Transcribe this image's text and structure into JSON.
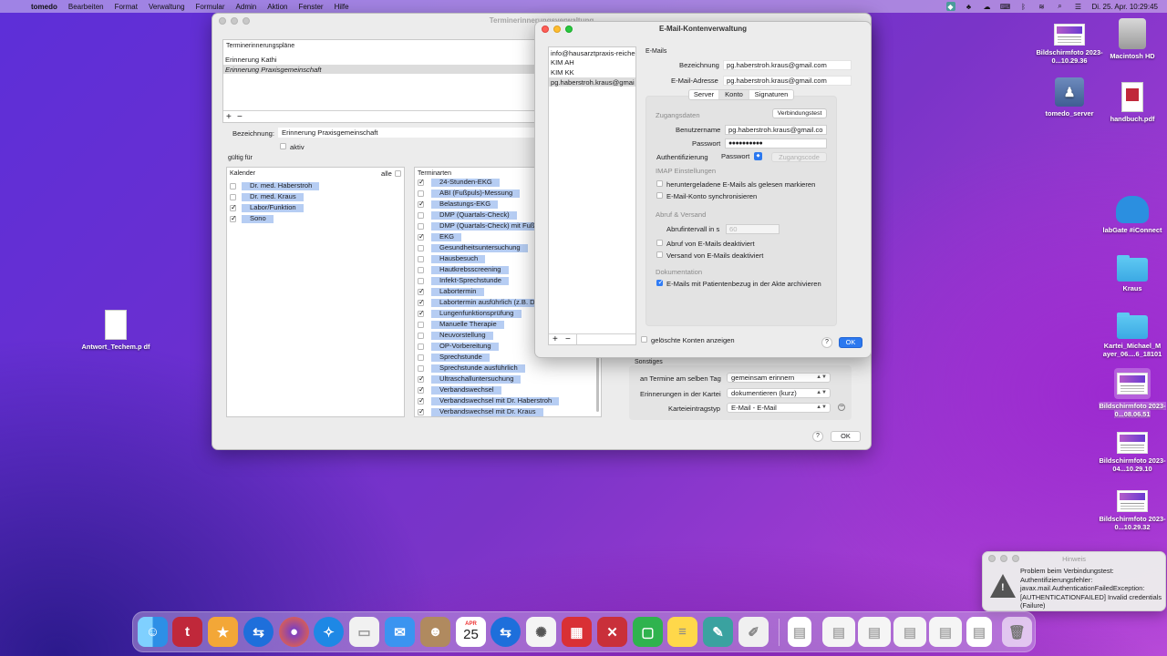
{
  "menubar": {
    "app": "tomedo",
    "items": [
      "Bearbeiten",
      "Format",
      "Verwaltung",
      "Formular",
      "Admin",
      "Aktion",
      "Fenster",
      "Hilfe"
    ],
    "clock": "Di. 25. Apr. 10:29:45"
  },
  "bg_window": {
    "title": "Terminerinnerungsverwaltung",
    "plans_header": "Terminerinnerungspläne",
    "plans": [
      "Erinnerung Kathi",
      "Erinnerung Praxisgemeinschaft"
    ],
    "add_btn": "+",
    "remove_btn": "−",
    "bezeichnung_label": "Bezeichnung:",
    "bezeichnung_value": "Erinnerung Praxisgemeinschaft",
    "aktiv_label": "aktiv",
    "gueltig_label": "gültig für",
    "kalender_header": "Kalender",
    "alle_label": "alle",
    "kalender": [
      {
        "label": "Dr. med. Haberstroh",
        "checked": false
      },
      {
        "label": "Dr. med. Kraus",
        "checked": false
      },
      {
        "label": "Labor/Funktion",
        "checked": true
      },
      {
        "label": "Sono",
        "checked": true
      }
    ],
    "terminarten_header": "Terminarten",
    "terminarten": [
      {
        "label": "24-Stunden-EKG",
        "checked": true
      },
      {
        "label": "ABI (Fußpuls)-Messung",
        "checked": false
      },
      {
        "label": "Belastungs-EKG",
        "checked": true
      },
      {
        "label": "DMP (Quartals-Check)",
        "checked": false
      },
      {
        "label": "DMP (Quartals-Check) mit Fußko",
        "checked": false
      },
      {
        "label": "EKG",
        "checked": true
      },
      {
        "label": "Gesundheitsuntersuchung",
        "checked": false
      },
      {
        "label": "Hausbesuch",
        "checked": false
      },
      {
        "label": "Hautkrebsscreening",
        "checked": false
      },
      {
        "label": "Infekt-Sprechstunde",
        "checked": false
      },
      {
        "label": "Labortermin",
        "checked": true
      },
      {
        "label": "Labortermin ausführlich (z.B. DM",
        "checked": true
      },
      {
        "label": "Lungenfunktionsprüfung",
        "checked": true
      },
      {
        "label": "Manuelle Therapie",
        "checked": false
      },
      {
        "label": "Neuvorstellung",
        "checked": false
      },
      {
        "label": "OP-Vorbereitung",
        "checked": false
      },
      {
        "label": "Sprechstunde",
        "checked": false
      },
      {
        "label": "Sprechstunde ausführlich",
        "checked": false
      },
      {
        "label": "Ultraschalluntersuchung",
        "checked": true
      },
      {
        "label": "Verbandswechsel",
        "checked": true
      },
      {
        "label": "Verbandswechsel mit Dr. Haberstroh",
        "checked": true
      },
      {
        "label": "Verbandswechsel mit Dr. Kraus",
        "checked": true
      }
    ],
    "sonstiges_label": "Sonstiges",
    "same_day_label": "an Termine am selben Tag",
    "same_day_value": "gemeinsam erinnern",
    "kartei_label": "Erinnerungen in der Kartei",
    "kartei_value": "dokumentieren (kurz)",
    "eintragstyp_label": "Karteieintragstyp",
    "eintragstyp_value": "E-Mail - E-Mail",
    "help": "?",
    "ok": "OK"
  },
  "email_window": {
    "title": "E-Mail-Kontenverwaltung",
    "accounts": [
      "info@hausarztpraxis-reiche",
      "KIM AH",
      "KIM KK",
      "pg.haberstroh.kraus@gmai"
    ],
    "emails_header": "E-Mails",
    "bezeichnung_label": "Bezeichnung",
    "bezeichnung_value": "pg.haberstroh.kraus@gmail.com",
    "adresse_label": "E-Mail-Adresse",
    "adresse_value": "pg.haberstroh.kraus@gmail.com",
    "tabs": [
      "Server",
      "Konto",
      "Signaturen"
    ],
    "zugang_header": "Zugangsdaten",
    "verbindungstest": "Verbindungstest",
    "benutzer_label": "Benutzername",
    "benutzer_value": "pg.haberstroh.kraus@gmail.co",
    "passwort_label": "Passwort",
    "passwort_value": "●●●●●●●●●●",
    "auth_label": "Authentifizierung",
    "auth_value": "Passwort",
    "zugangscode": "Zugangscode",
    "imap_header": "IMAP Einstellungen",
    "imap_opt1": "heruntergeladene E-Mails als gelesen markieren",
    "imap_opt2": "E-Mail-Konto synchronisieren",
    "abruf_header": "Abruf & Versand",
    "abruf_interval_label": "Abrufintervall in s",
    "abruf_interval_value": "60",
    "abruf_opt1": "Abruf von E-Mails deaktiviert",
    "abruf_opt2": "Versand von E-Mails deaktiviert",
    "doku_header": "Dokumentation",
    "doku_opt": "E-Mails mit Patientenbezug in der Akte archivieren",
    "deleted_label": "gelöschte Konten anzeigen",
    "add_btn": "+",
    "remove_btn": "−",
    "help": "?",
    "ok": "OK"
  },
  "desktop_icons": [
    {
      "name": "Bildschirmfoto 2023-0...10.29.36"
    },
    {
      "name": "Macintosh HD"
    },
    {
      "name": "tomedo_server"
    },
    {
      "name": "handbuch.pdf"
    },
    {
      "name": "labGate #iConnect"
    },
    {
      "name": "Kraus"
    },
    {
      "name": "Kartei_Michael_M ayer_06....6_18101"
    },
    {
      "name": "Bildschirmfoto 2023-0...08.06.51"
    },
    {
      "name": "Bildschirmfoto 2023-04...10.29.10"
    },
    {
      "name": "Bildschirmfoto 2023-0...10.29.32"
    },
    {
      "name": "Antwort_Techem.p df"
    }
  ],
  "notification": {
    "title": "Hinweis",
    "message": "Problem beim Verbindungstest: Authentifizierungsfehler: javax.mail.AuthenticationFailedException: [AUTHENTICATIONFAILED] Invalid credentials (Failure)"
  },
  "dock": {
    "calendar_month": "APR",
    "calendar_day": "25"
  }
}
